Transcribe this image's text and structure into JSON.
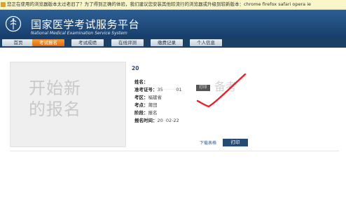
{
  "browser_warning": "您正在使用的浏览器版本太过老旧了？为了得到正确的体验，我们建议您安装其他较流行的浏览器或升级到较新版本：chrome firefox safari opera ie",
  "header": {
    "title_cn": "国家医学考试服务平台",
    "title_en": "National Medical Examination Service System"
  },
  "nav": {
    "tabs": [
      {
        "label": "首页"
      },
      {
        "label": "考试报名"
      },
      {
        "label": "考试成绩"
      },
      {
        "label": "在线评测"
      },
      {
        "label": "缴费记录"
      },
      {
        "label": "个人信息"
      }
    ],
    "active_index": 1
  },
  "card": {
    "text_line1": "开始新",
    "text_line2": "的报名"
  },
  "form": {
    "heading": "20",
    "name_label": "姓名：",
    "name_value": "",
    "ticket_label": "准考证号：",
    "ticket_value": "35",
    "ticket_value_tail": "01",
    "ticket_print": "打印",
    "ghost_text": "备考",
    "area_label": "考区：",
    "area_value": "福建省",
    "site_label": "考点：",
    "site_value": "莆田",
    "stage_label": "阶段：",
    "stage_value": "报名",
    "time_label": "报名时间：",
    "time_value": "20",
    "time_value_tail": "02-22"
  },
  "actions": {
    "download": "下载表格",
    "print": "打印"
  },
  "colors": {
    "header_top": "#2d5e93",
    "nav_active": "#df6a12",
    "scribble": "#e8202a"
  }
}
